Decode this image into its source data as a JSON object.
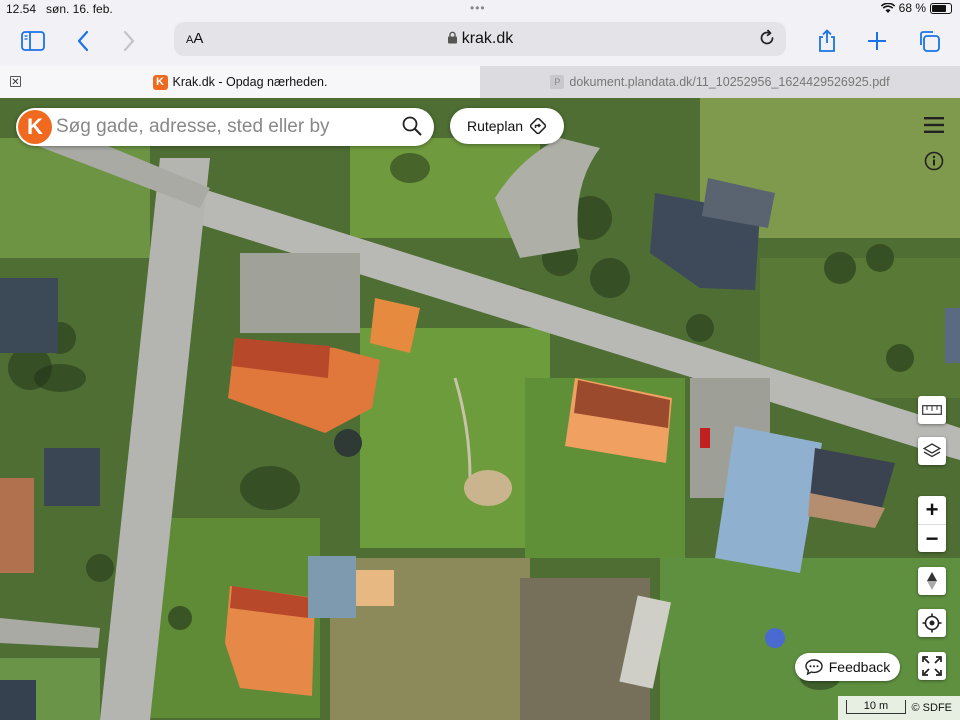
{
  "status_bar": {
    "time": "12.54",
    "date": "søn. 16. feb.",
    "battery": "68 %"
  },
  "toolbar": {
    "text_size_label_small": "A",
    "text_size_label_large": "A",
    "url": "krak.dk"
  },
  "tabs": [
    {
      "title": "Krak.dk - Opdag nærheden.",
      "favicon": "K",
      "active": true
    },
    {
      "title": "dokument.plandata.dk/11_10252956_1624429526925.pdf",
      "favicon": "P",
      "active": false
    }
  ],
  "map": {
    "logo_letter": "K",
    "search_placeholder": "Søg gade, adresse, sted eller by",
    "route_button": "Ruteplan",
    "feedback_button": "Feedback",
    "scale_label": "10 m",
    "attribution": "© SDFE",
    "zoom_in": "+",
    "zoom_out": "−"
  },
  "colors": {
    "accent": "#1a73e8",
    "brand": "#ef6a1f"
  }
}
